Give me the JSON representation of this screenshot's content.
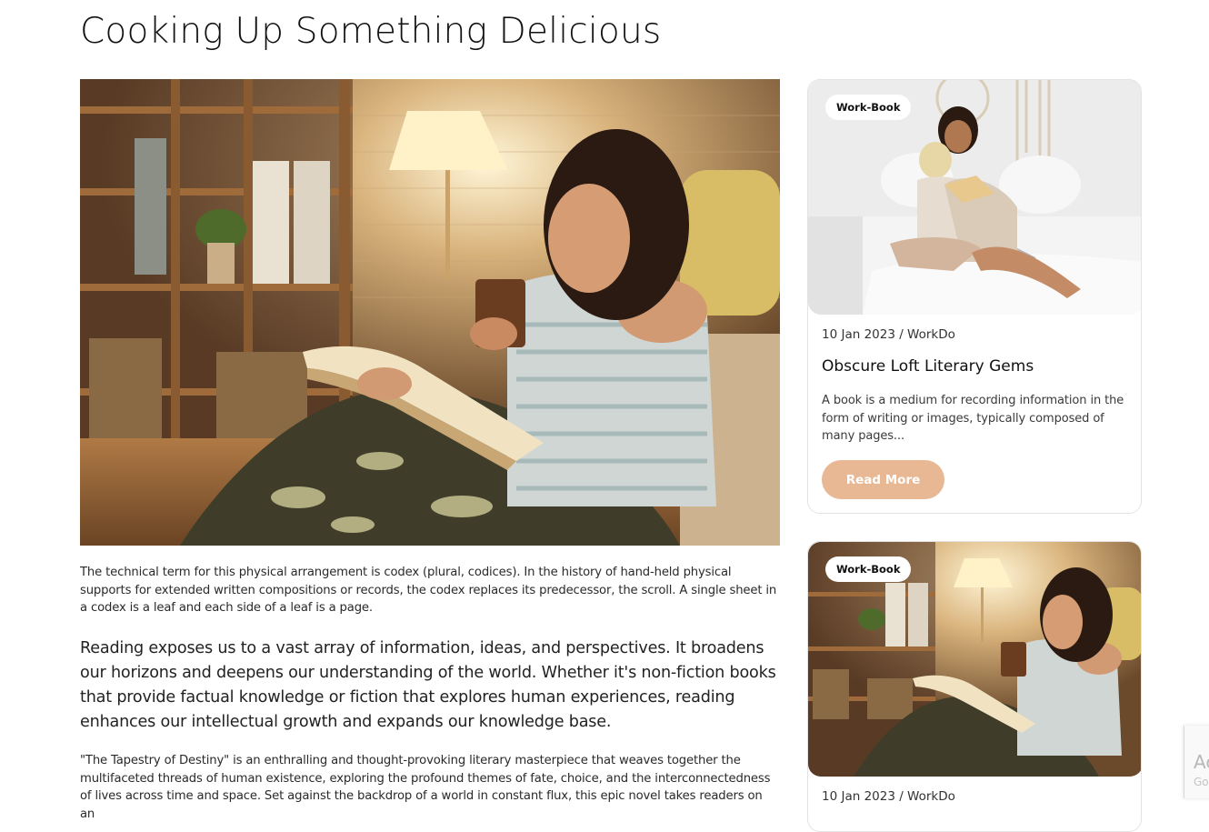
{
  "page": {
    "title": "Cooking Up Something Delicious"
  },
  "article": {
    "paragraph_1": "The technical term for this physical arrangement is codex (plural, codices). In the history of hand-held physical supports for extended written compositions or records, the codex replaces its predecessor, the scroll. A single sheet in a codex is a leaf and each side of a leaf is a page.",
    "paragraph_2": "Reading exposes us to a vast array of information, ideas, and perspectives. It broadens our horizons and deepens our understanding of the world. Whether it's non-fiction books that provide factual knowledge or fiction that explores human experiences, reading enhances our intellectual growth and expands our knowledge base.",
    "paragraph_3": "\"The Tapestry of Destiny\" is an enthralling and thought-provoking literary masterpiece that weaves together the multifaceted threads of human existence, exploring the profound themes of fate, choice, and the interconnectedness of lives across time and space. Set against the backdrop of a world in constant flux, this epic novel takes readers on an"
  },
  "sidebar": {
    "cards": [
      {
        "tag": "Work-Book",
        "meta": "10 Jan 2023 / WorkDo",
        "title": "Obscure Loft Literary Gems",
        "description": "A book is a medium for recording information in the form of writing or images, typically composed of many pages...",
        "button_label": "Read More"
      },
      {
        "tag": "Work-Book",
        "meta": "10 Jan 2023 / WorkDo"
      }
    ]
  },
  "recaptcha": {
    "line_1": "Ac",
    "line_2": "Go"
  },
  "colors": {
    "accent_button": "#e8b894",
    "tag_background": "#ffffff",
    "card_border": "#e3e3e3"
  },
  "icons": {
    "hero_image": "woman-reading-book-with-mug",
    "card_1_image": "two-women-reading-on-bed",
    "card_2_image": "woman-reading-book-with-mug"
  }
}
